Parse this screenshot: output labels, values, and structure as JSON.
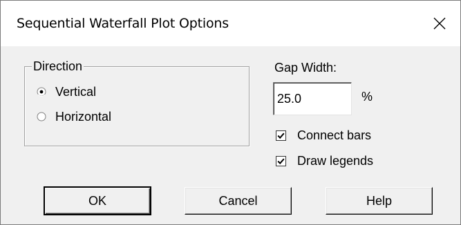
{
  "window": {
    "title": "Sequential Waterfall Plot Options",
    "close_glyph": "✕"
  },
  "direction_group": {
    "label": "Direction",
    "options": [
      {
        "label": "Vertical",
        "selected": true
      },
      {
        "label": "Horizontal",
        "selected": false
      }
    ]
  },
  "gap_width": {
    "label": "Gap Width:",
    "value": "25.0",
    "unit": "%"
  },
  "checkboxes": [
    {
      "label": "Connect bars",
      "checked": true
    },
    {
      "label": "Draw legends",
      "checked": true
    }
  ],
  "buttons": {
    "ok": "OK",
    "cancel": "Cancel",
    "help": "Help"
  }
}
